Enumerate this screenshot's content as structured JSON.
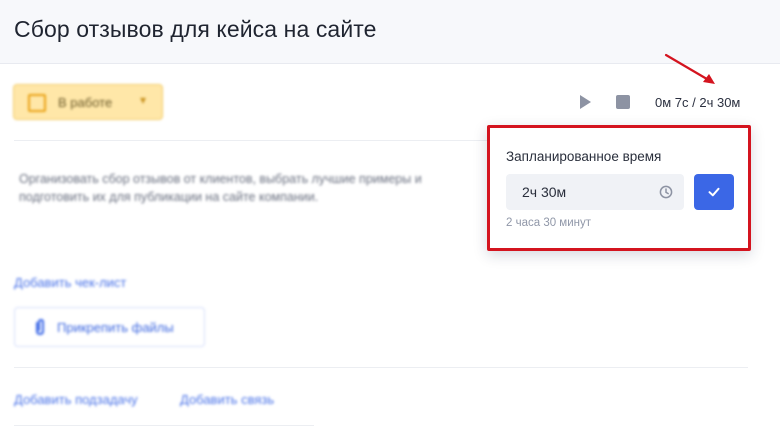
{
  "header": {
    "title": "Сбор отзывов для кейса на сайте"
  },
  "status": {
    "label": "В работе",
    "icon": "checkbox-icon",
    "accent": "#ffe7a8"
  },
  "timer": {
    "play_icon": "play-icon",
    "stop_icon": "stop-icon",
    "readout": "0м 7с / 2ч 30м"
  },
  "description": "Организовать сбор отзывов от клиентов, выбрать лучшие примеры и подготовить их для публикации на сайте компании.",
  "links": {
    "add_checklist": "Добавить чек-лист",
    "attach_files": "Прикрепить файлы",
    "add_subtask": "Добавить подзадачу",
    "add_relation": "Добавить связь"
  },
  "popover": {
    "title": "Запланированное время",
    "input_value": "2ч 30м",
    "hint": "2 часа 30 минут",
    "confirm_icon": "check-icon",
    "confirm_color": "#3b67e6",
    "highlight_color": "#d4141f"
  }
}
